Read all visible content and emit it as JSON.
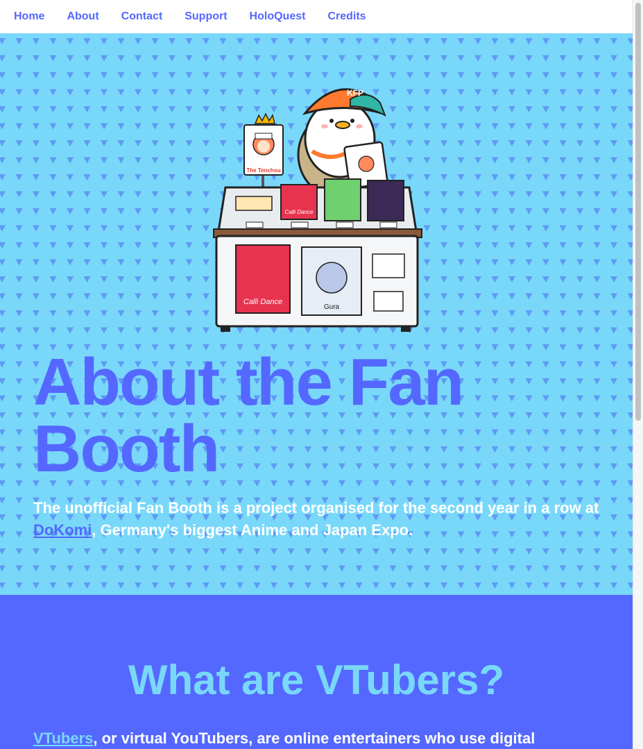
{
  "nav": {
    "items": [
      "Home",
      "About",
      "Contact",
      "Support",
      "HoloQuest",
      "Credits"
    ]
  },
  "hero": {
    "title": "About the Fan Booth",
    "text_before": "The unofficial Fan Booth is a project organised for the second year in a row at ",
    "link": "DoKomi",
    "text_after": ", Germany's biggest Anime and Japan Expo.",
    "illustration": {
      "cap_text": "KFP",
      "sign_text": "The Tenchou",
      "book_labels": [
        "Calli Dance",
        "Calli Dance",
        "Gura"
      ]
    }
  },
  "vtubers": {
    "title": "What are VTubers?",
    "link": "VTubers",
    "text_after": ", or virtual YouTubers, are online entertainers who use digital"
  },
  "colors": {
    "nav_link": "#5468ff",
    "hero_bg": "#79d8f9",
    "triangle": "#5a8ff4",
    "section_bg": "#5468ff",
    "section_title": "#79d8f9"
  }
}
